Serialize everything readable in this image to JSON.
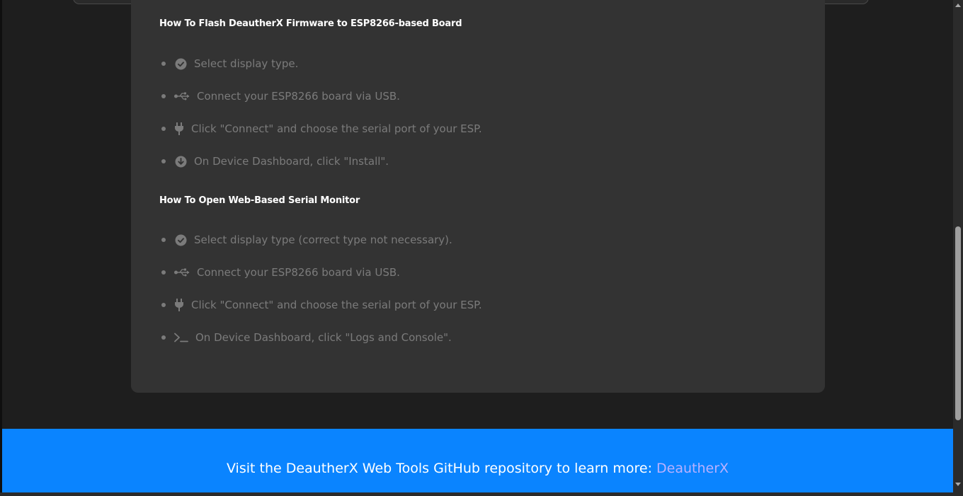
{
  "sections": [
    {
      "heading": "How To Flash DeautherX Firmware to ESP8266-based Board",
      "steps": [
        {
          "icon": "check-circle-icon",
          "text": "Select display type."
        },
        {
          "icon": "usb-icon",
          "text": "Connect your ESP8266 board via USB."
        },
        {
          "icon": "plug-icon",
          "text": "Click \"Connect\" and choose the serial port of your ESP."
        },
        {
          "icon": "download-circle-icon",
          "text": "On Device Dashboard, click \"Install\"."
        }
      ]
    },
    {
      "heading": "How To Open Web-Based Serial Monitor",
      "steps": [
        {
          "icon": "check-circle-icon",
          "text": "Select display type (correct type not necessary)."
        },
        {
          "icon": "usb-icon",
          "text": "Connect your ESP8266 board via USB."
        },
        {
          "icon": "plug-icon",
          "text": "Click \"Connect\" and choose the serial port of your ESP."
        },
        {
          "icon": "terminal-icon",
          "text": "On Device Dashboard, click \"Logs and Console\"."
        }
      ]
    }
  ],
  "footer": {
    "text": "Visit the DeautherX Web Tools GitHub repository to learn more:",
    "link_label": "DeautherX"
  },
  "colors": {
    "footer_bg": "#0a84ff",
    "link": "#b9b1ff",
    "card_bg": "#333333",
    "page_bg": "#1e1e1e"
  }
}
